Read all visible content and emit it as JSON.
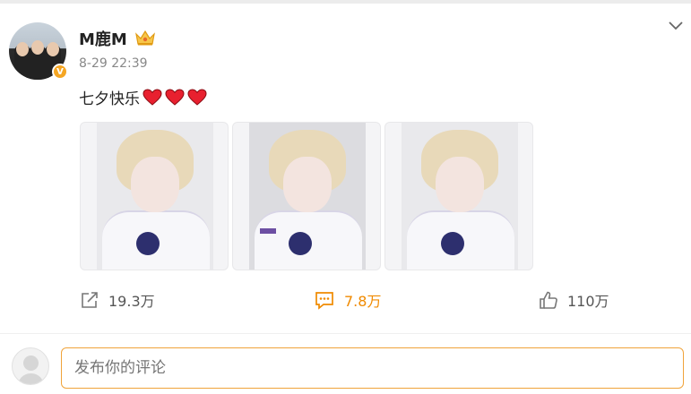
{
  "post": {
    "username": "M鹿M",
    "timestamp": "8-29 22:39",
    "text": "七夕快乐",
    "verified_badge": "V"
  },
  "actions": {
    "repost_count": "19.3万",
    "comment_count": "7.8万",
    "like_count": "110万"
  },
  "comment": {
    "placeholder": "发布你的评论"
  },
  "colors": {
    "accent": "#f08a00",
    "heart": "#e8202f",
    "badge": "#f5a623"
  },
  "icons": [
    "crown-icon",
    "chevron-down-icon",
    "heart-icon",
    "repost-icon",
    "comment-icon",
    "like-icon"
  ]
}
